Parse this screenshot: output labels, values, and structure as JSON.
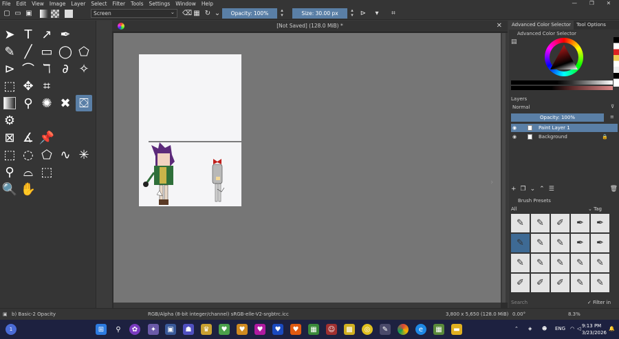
{
  "menu": [
    "File",
    "Edit",
    "View",
    "Image",
    "Layer",
    "Select",
    "Filter",
    "Tools",
    "Settings",
    "Window",
    "Help"
  ],
  "toolbar": {
    "blend_mode": "Screen",
    "opacity": "Opacity: 100%",
    "size": "Size: 30.00 px"
  },
  "document": {
    "tab_title": "[Not Saved]  (128.0 MiB) *"
  },
  "right_panel": {
    "tabs": [
      "Advanced Color Selector",
      "Tool Options"
    ],
    "acs_title": "Advanced Color Selector",
    "layers_title": "Layers",
    "layers_blend": "Normal",
    "layers_opacity": "Opacity:  100%",
    "layers": [
      {
        "name": "Paint Layer 1",
        "selected": true
      },
      {
        "name": "Background",
        "selected": false
      }
    ],
    "brush_presets_title": "Brush Presets",
    "brush_filter": "All",
    "tag_label": "Tag",
    "search_placeholder": "Search",
    "filter_in_tag": "Filter in Tag"
  },
  "status": {
    "left": "b) Basic-2 Opacity",
    "color": "RGB/Alpha (8-bit integer/channel)  sRGB-elle-V2-srgbtrc.icc",
    "dims": "3,800 x 5,650 (128.0 MiB)",
    "rotation": "0.00°",
    "zoom": "8.3%"
  },
  "taskbar": {
    "lang": "ENG",
    "time": "9:13 PM",
    "date": "3/23/2026",
    "weather_badge": "1"
  },
  "colors": {
    "accent": "#5a7fa6",
    "panel": "#353535",
    "canvas_bg": "#767676"
  }
}
